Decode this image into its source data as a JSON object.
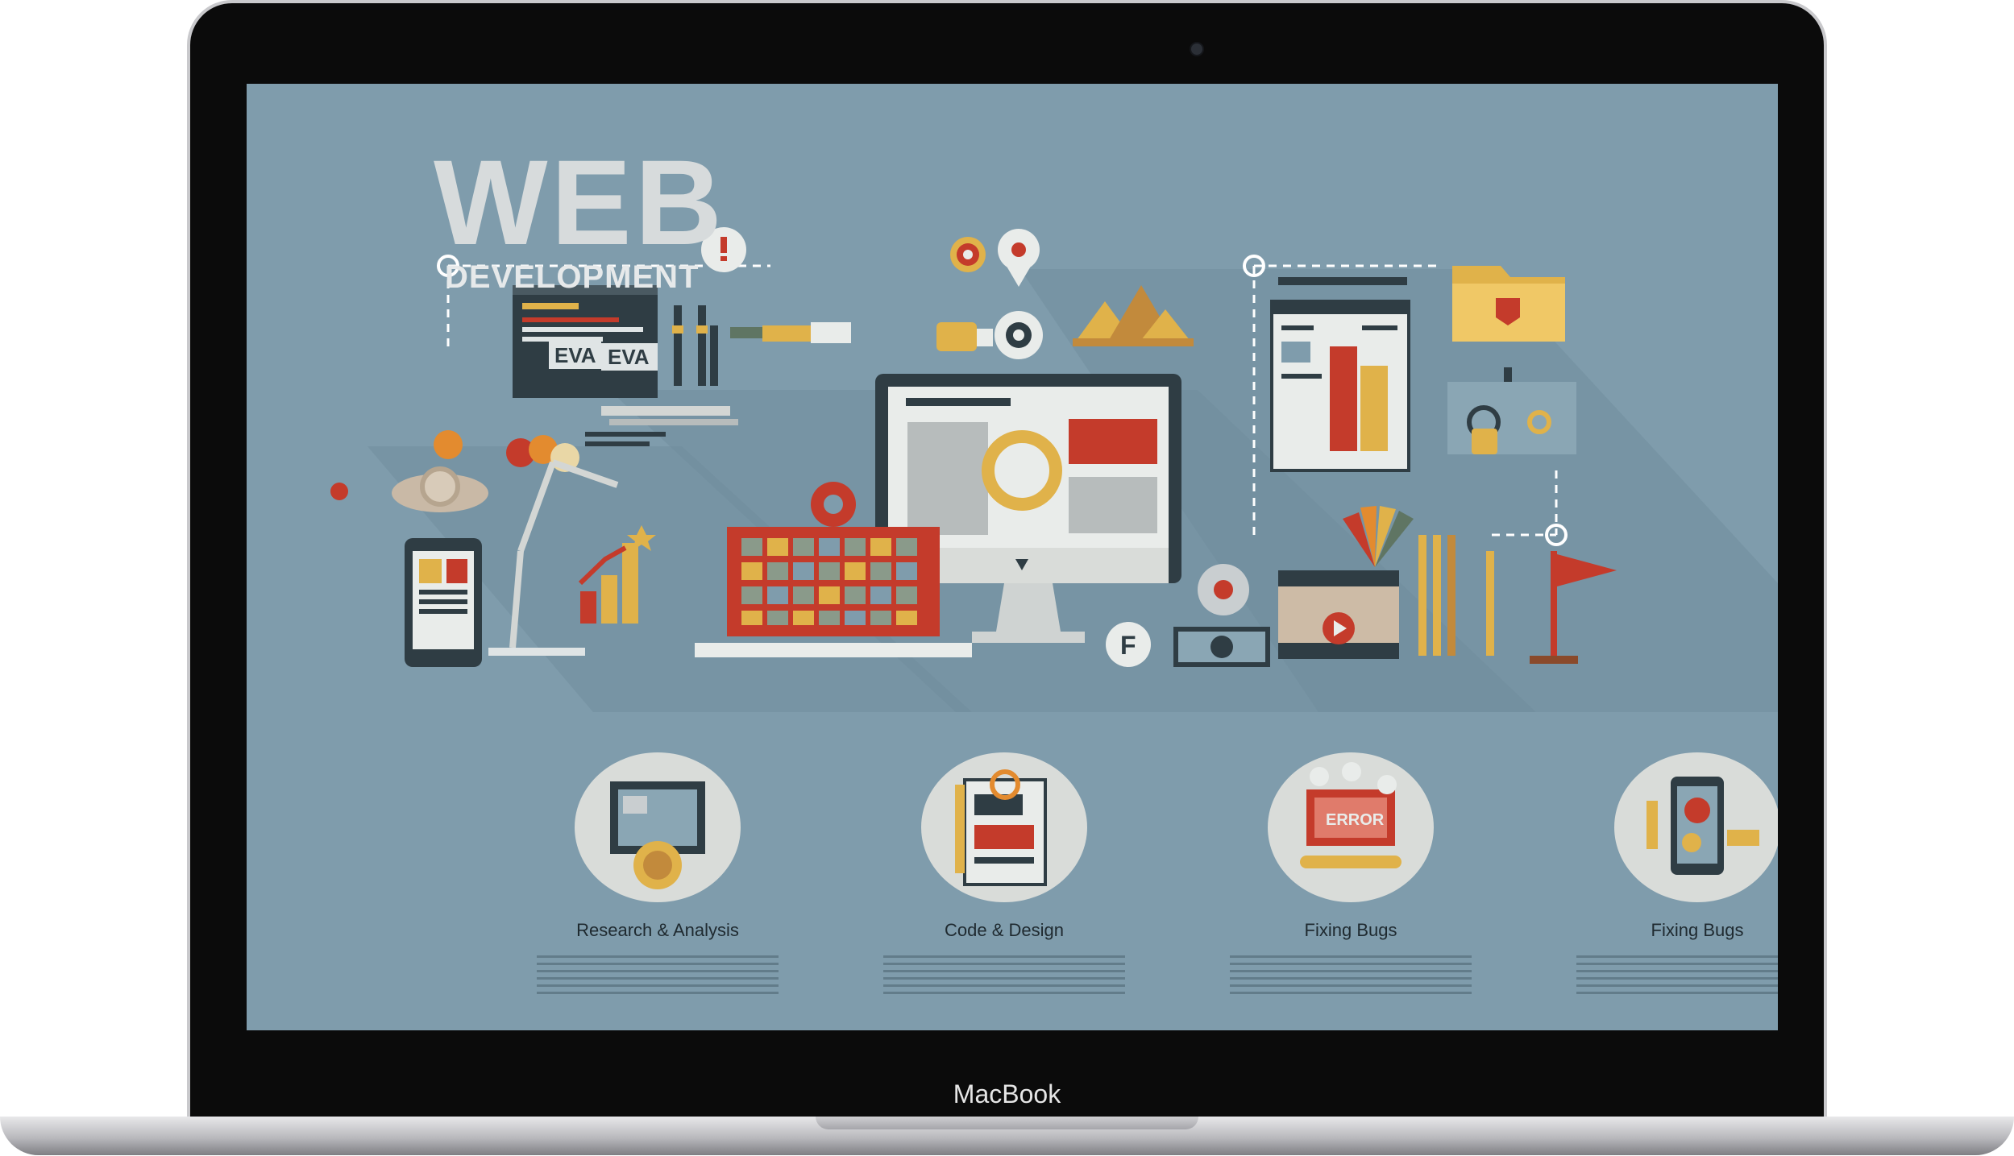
{
  "device": {
    "brand_label": "MacBook"
  },
  "hero": {
    "title": "WEB",
    "subtitle": "DEVELOPMENT"
  },
  "services": [
    {
      "label": "Research & Analysis",
      "icon": "research-analysis-icon"
    },
    {
      "label": "Code & Design",
      "icon": "code-design-icon"
    },
    {
      "label": "Fixing Bugs",
      "icon": "fixing-bugs-icon"
    },
    {
      "label": "Fixing Bugs",
      "icon": "mobile-settings-icon"
    }
  ],
  "illustration": {
    "window_text_1": "EVA",
    "window_text_2": "EVA",
    "error_text": "ERROR"
  },
  "colors": {
    "background": "#7f9cac",
    "accent_red": "#c43b2b",
    "accent_orange": "#e38b2f",
    "accent_yellow": "#e0b24a",
    "frame": "#0b0b0b"
  }
}
